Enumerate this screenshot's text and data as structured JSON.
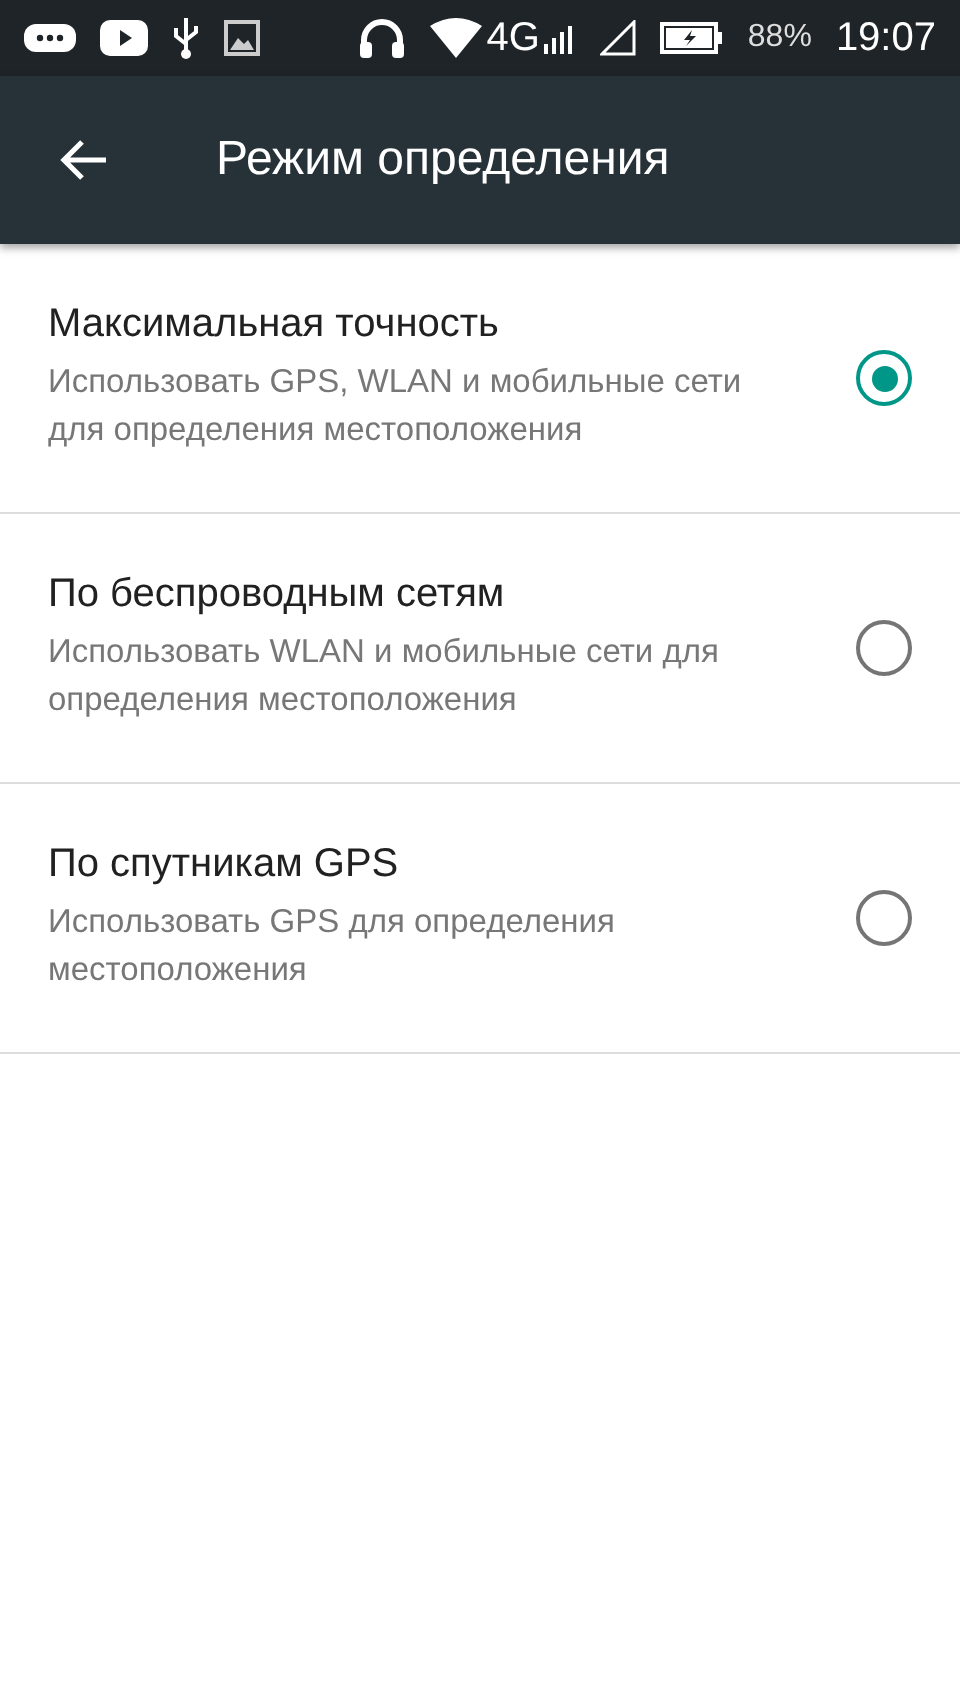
{
  "status_bar": {
    "network": "4G",
    "battery": "88%",
    "time": "19:07"
  },
  "toolbar": {
    "title": "Режим определения"
  },
  "options": [
    {
      "title": "Максимальная точность",
      "subtitle": "Использовать GPS, WLAN и мобильные сети для определения местоположения",
      "selected": true
    },
    {
      "title": "По беспроводным сетям",
      "subtitle": "Использовать WLAN и мобильные сети для определения местоположения",
      "selected": false
    },
    {
      "title": "По спутникам GPS",
      "subtitle": "Использовать GPS для определения местоположения",
      "selected": false
    }
  ]
}
